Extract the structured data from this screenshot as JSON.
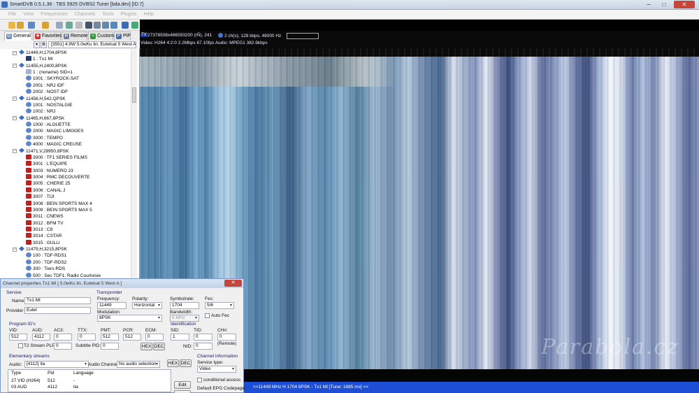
{
  "window": {
    "title": "SmartDVB 0.5.1.38 : TBS 5925 DVBS2 Tuner [bda.dev]  [ID:7]",
    "min": "─",
    "max": "□",
    "close": "✕"
  },
  "menu": [
    "File",
    "View",
    "Frequencies",
    "Channels",
    "Tools",
    "Plugins",
    "Help"
  ],
  "tabs": [
    {
      "label": "General",
      "icon": "G"
    },
    {
      "label": "Favorites",
      "icon": "★"
    },
    {
      "label": "Remote",
      "icon": "R"
    },
    {
      "label": "Custom",
      "icon": "+"
    },
    {
      "label": "PiP",
      "icon": "P"
    }
  ],
  "satellite": {
    "selected": "[3551]  4.9W  5.0wKu lin. Eutelsat 5 West A"
  },
  "tree": [
    {
      "label": "11449,H,1704,8PSK",
      "kind": "transponder",
      "level": 0
    },
    {
      "label": "1 : Tx1 MI",
      "kind": "tvdark",
      "level": 1
    },
    {
      "label": "11455,H,2400,8PSK",
      "kind": "transponder",
      "level": 0
    },
    {
      "label": "1 : (noname) SID=1",
      "kind": "data",
      "level": 1
    },
    {
      "label": "1001 : SKYROCK-SAT",
      "kind": "radio",
      "level": 1
    },
    {
      "label": "2001 : NRJ IDF",
      "kind": "radio",
      "level": 1
    },
    {
      "label": "2002 : NOST IDF",
      "kind": "radio",
      "level": 1
    },
    {
      "label": "11458,H,542,QPSK",
      "kind": "transponder",
      "level": 0
    },
    {
      "label": "1001 : NOSTALGIE",
      "kind": "radio",
      "level": 1
    },
    {
      "label": "1002 : NRJ",
      "kind": "radio",
      "level": 1
    },
    {
      "label": "11465,H,667,8PSK",
      "kind": "transponder",
      "level": 0
    },
    {
      "label": "1000 : ALOUETTE",
      "kind": "radio",
      "level": 1
    },
    {
      "label": "2000 : MAGIC LIMOGES",
      "kind": "radio",
      "level": 1
    },
    {
      "label": "3000 : TEMPO",
      "kind": "radio",
      "level": 1
    },
    {
      "label": "4000 : MAGIC CREUSE",
      "kind": "radio",
      "level": 1
    },
    {
      "label": "11471,V,29950,8PSK",
      "kind": "transponder",
      "level": 0
    },
    {
      "label": "3000 : TF1 SERIES FILMS",
      "kind": "tv",
      "level": 1
    },
    {
      "label": "3001 : L'EQUIPE",
      "kind": "tv",
      "level": 1
    },
    {
      "label": "3003 : NUMERO 23",
      "kind": "tv",
      "level": 1
    },
    {
      "label": "3004 : RMC DECOUVERTE",
      "kind": "tv",
      "level": 1
    },
    {
      "label": "3005 : CHERIE 25",
      "kind": "tv",
      "level": 1
    },
    {
      "label": "3006 : CANAL J",
      "kind": "tv",
      "level": 1
    },
    {
      "label": "3007 : TIJI",
      "kind": "tv",
      "level": 1
    },
    {
      "label": "3008 : BEIN SPORTS MAX 4",
      "kind": "tv",
      "level": 1
    },
    {
      "label": "3009 : BEIN SPORTS MAX 5",
      "kind": "tv",
      "level": 1
    },
    {
      "label": "3011 : CNEWS",
      "kind": "tv",
      "level": 1
    },
    {
      "label": "3012 : BFM TV",
      "kind": "tv",
      "level": 1
    },
    {
      "label": "3013 : C8",
      "kind": "tv",
      "level": 1
    },
    {
      "label": "3014 : CSTAR",
      "kind": "tv",
      "level": 1
    },
    {
      "label": "3015 : GULLI",
      "kind": "tv",
      "level": 1
    },
    {
      "label": "11479,H,3215,8PSK",
      "kind": "transponder",
      "level": 0
    },
    {
      "label": "100 : TDF-RDS1",
      "kind": "radio",
      "level": 1
    },
    {
      "label": "200 : TDF-RDS2",
      "kind": "radio",
      "level": 1
    },
    {
      "label": "300 : Tiers-RDS",
      "kind": "radio",
      "level": 1
    },
    {
      "label": "500 : Sec TDF1: Radio Courtoisie",
      "kind": "radio",
      "level": 1
    }
  ],
  "video_info": {
    "tv_label": "TV",
    "line1_left": "27378508x486593200 (rÑ), 241",
    "line1_audio": "2 ch(s), 128 kbps, 48000 Hz",
    "line2": "Video: H264  4:2:0  2.2Mbps  67.10fps     Audio: MPEG1  382.9kbps"
  },
  "status": {
    "text": ">>11449 MHz H 1704 8PSK - Tx1 MI [Tune: 1685 ms] <<"
  },
  "watermark": "Parabola.cz",
  "dialog": {
    "title": "Channel properties Tx1 MI [ 5.0wKu lin. Eutelsat 5 West A ]",
    "close": "✕",
    "service_section": "Service",
    "name_label": "Name:",
    "name_value": "Tx1 MI",
    "provider_label": "Provider:",
    "provider_value": "Eutel",
    "transponder_section": "Transponder",
    "frequency_label": "Frequency:",
    "frequency_value": "11449",
    "polarity_label": "Polarity:",
    "polarity_value": "Horizontal",
    "symbolrate_label": "Symbolrate:",
    "symbolrate_value": "1704",
    "fec_label": "Fec:",
    "fec_value": "5/6",
    "modulation_label": "Modulation:",
    "modulation_value": "8PSK",
    "bandwidth_label": "Bandwidth:",
    "bandwidth_value": "6 MHz",
    "autofec_label": "Auto Fec",
    "program_ids_section": "Program ID's",
    "vid_label": "VID:",
    "vid_value": "512",
    "aud_label": "AUD:",
    "aud_value": "4112",
    "ac3_label": "AC3:",
    "ac3_value": "0",
    "ttx_label": "TTX:",
    "ttx_value": "0",
    "pmt_label": "PMT:",
    "pmt_value": "512",
    "pcr_label": "PCR:",
    "pcr_value": "512",
    "ecm_label": "ECM:",
    "ecm_value": "0",
    "t2plp_label": "T2 Stream PLP",
    "t2plp_value": "0",
    "subtitle_label": "Subtitle PID:",
    "subtitle_value": "0",
    "hex_label": "HEX",
    "dec_label": "DEC",
    "identification_section": "Identification",
    "sid_label": "SID:",
    "sid_value": "1",
    "tid_label": "TID:",
    "tid_value": "0",
    "chnum_label": "CH#:",
    "chnum_value": "0",
    "remote_label": "(Remote)",
    "nid_label": "NID:",
    "nid_value": "0",
    "elementary_section": "Elementary streams",
    "audio_label": "Audio:",
    "audio_value": "[4112] ita",
    "audio_channel_label": "Audio Channel:",
    "audio_channel_value": "No audio selection",
    "channel_info_section": "Channel information",
    "service_type_label": "Service type:",
    "service_type_value": "Video",
    "conditional_label": "conditional access",
    "epg_codepage_label": "Default EPG Codepage:",
    "edit_label": "Edit",
    "stream_headers": [
      "Type",
      "Pid",
      "Language"
    ],
    "streams": [
      {
        "type": "27 VID (H264)",
        "pid": "512",
        "lang": "-"
      },
      {
        "type": "03 AUD",
        "pid": "4112",
        "lang": "ita"
      }
    ]
  }
}
